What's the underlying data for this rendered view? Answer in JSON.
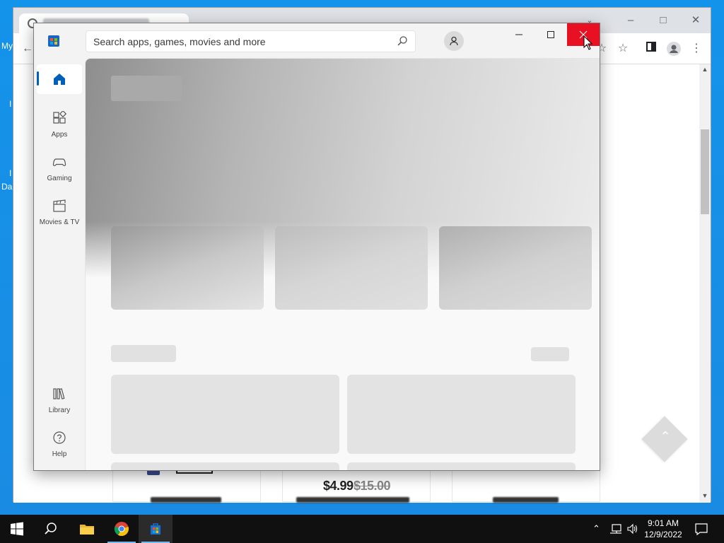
{
  "desktop": {
    "fragments": [
      "My",
      "I",
      "I",
      "Da"
    ]
  },
  "browser": {
    "background_prices": {
      "main": "$4.99",
      "old": "$15.00"
    }
  },
  "store": {
    "search": {
      "placeholder": "Search apps, games, movies and more"
    },
    "nav": {
      "apps": "Apps",
      "gaming": "Gaming",
      "movies_tv": "Movies & TV",
      "library": "Library",
      "help": "Help"
    },
    "colors": {
      "accent": "#005fb8",
      "close_hover": "#e81123"
    }
  },
  "taskbar": {
    "time": "9:01 AM",
    "date": "12/9/2022"
  }
}
